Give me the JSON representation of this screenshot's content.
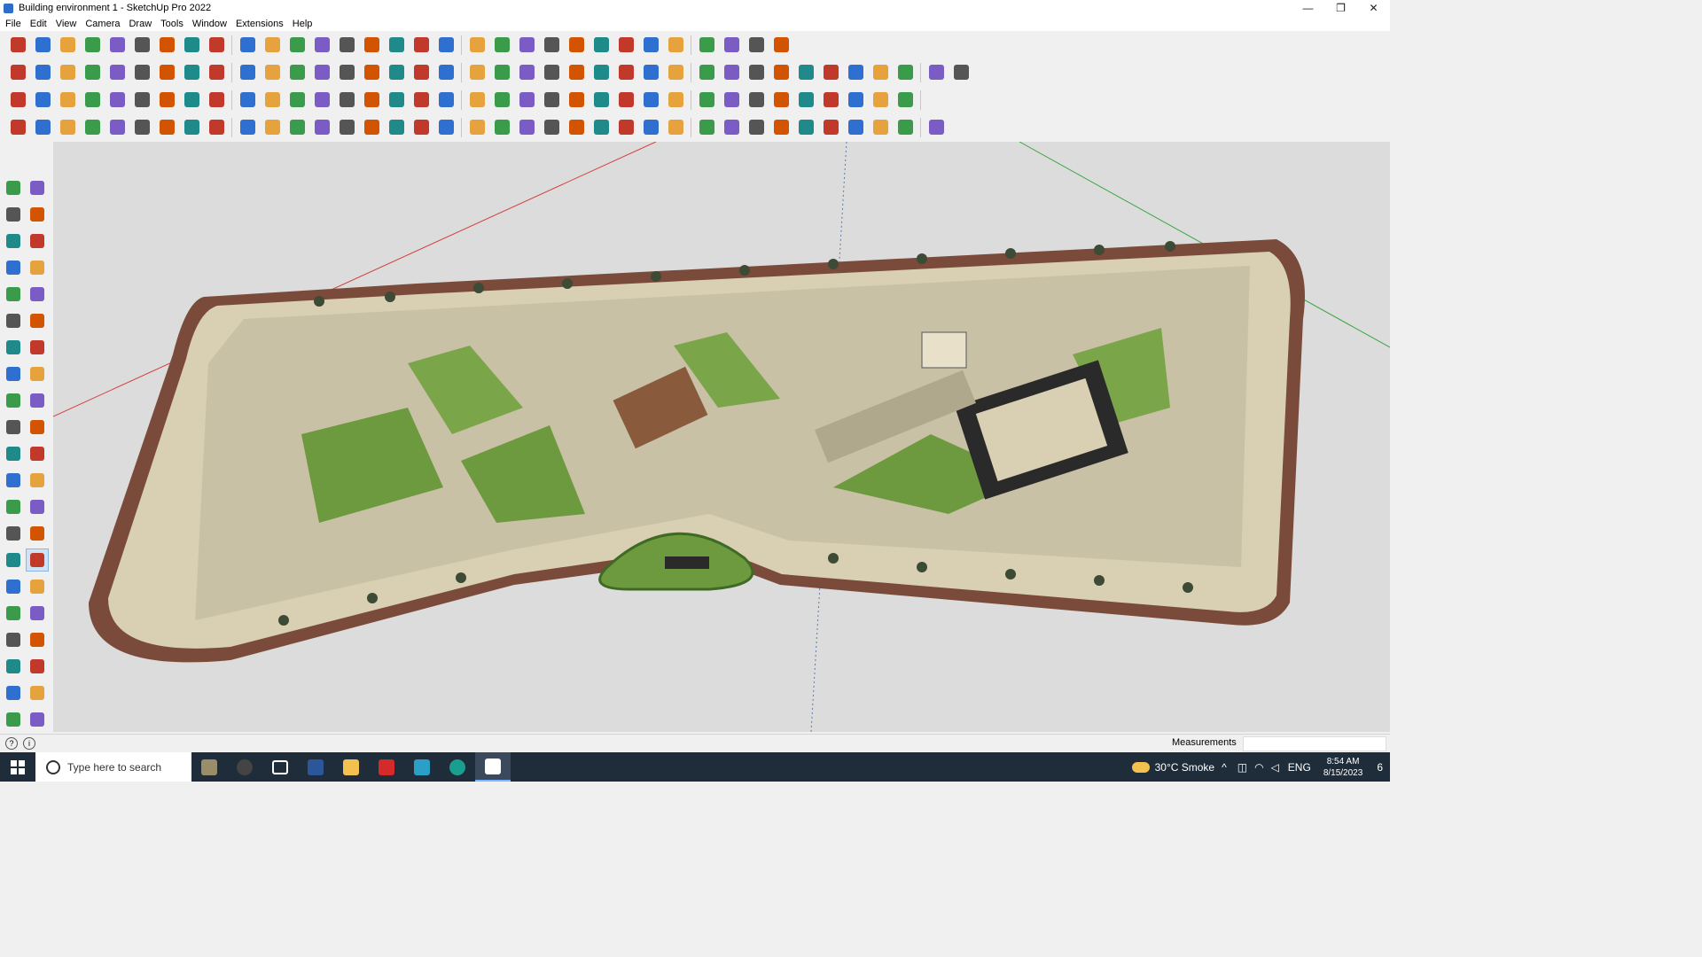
{
  "window": {
    "title": "Building environment 1 - SketchUp Pro 2022",
    "app_icon": "sketchup-icon",
    "minimize": "—",
    "restore": "❐",
    "close": "✕"
  },
  "menu": [
    "File",
    "Edit",
    "View",
    "Camera",
    "Draw",
    "Tools",
    "Window",
    "Extensions",
    "Help"
  ],
  "toolbars": {
    "row1": [
      "zoom-icon",
      "select-icon",
      "eraser-icon",
      "pencil-icon",
      "arc-icon",
      "rectangle-icon",
      "push-pull-icon",
      "follow-me-icon",
      "move-icon",
      "rotate-icon",
      "scale-icon",
      "tape-icon",
      "text-icon",
      "paint-icon",
      "orbit-icon",
      "pan-icon",
      "zoom-window-icon",
      "zoom-extents-icon",
      "warehouse-icon",
      "layers-icon",
      "styles-icon",
      "components-icon",
      "account-icon",
      "views-icon",
      "sections-icon",
      "axes-icon",
      "solids-icon",
      "sandbox-icon",
      "undo-icon",
      "redo-icon",
      "model-info-icon"
    ],
    "row2": [
      "iso-view-icon",
      "top-view-icon",
      "front-view-icon",
      "import-icon",
      "extrude-icon",
      "arrow-icon",
      "flip-icon",
      "mirror-icon",
      "copy-icon",
      "fillet-icon",
      "roof-icon",
      "wall-icon",
      "window-icon",
      "door-icon",
      "house-icon",
      "stairs-icon",
      "floor-icon",
      "formula-icon",
      "curve-icon",
      "line-icon",
      "square-icon",
      "circle-icon",
      "hexagon-icon",
      "ellipse-icon",
      "parallelogram-icon",
      "curve-tool-icon",
      "polygon-icon",
      "pen-icon",
      "shape-icon",
      "scale-tool-icon",
      "measure-icon",
      "eraser2-icon",
      "bezier-icon",
      "plane-icon",
      "grid-icon",
      "section-fill-icon",
      "tube-icon",
      "panel-icon"
    ],
    "row3": [
      "paint-bucket-icon",
      "ruler-icon",
      "label-icon",
      "attribute-icon",
      "close-small-icon",
      "triangle-icon",
      "loop-icon",
      "square-red-icon",
      "lines-icon",
      "panel-outline-icon",
      "bench-icon",
      "link-icon",
      "corner-icon",
      "node-icon",
      "cross-red-icon",
      "cross-green-icon",
      "cross-blue-icon",
      "cone-icon",
      "triangle-outline-icon",
      "lasso-icon",
      "cut-icon",
      "rotate-small-icon",
      "move-small-icon",
      "bucket-icon",
      "undo-red-icon",
      "component-icon",
      "bond-icon",
      "stack-icon",
      "gear-red-icon",
      "chip-icon",
      "structure-icon",
      "lattice-icon",
      "grid2-icon",
      "scatter-icon",
      "curve2-icon",
      "cube-icon"
    ],
    "row4": [
      "vertex-icon",
      "spline-icon",
      "terrain-icon",
      "draw-icon",
      "paper-icon",
      "flat-icon",
      "twist-icon",
      "pipe-icon",
      "gear-icon",
      "wrench-icon",
      "elbow-icon",
      "arrow-icon2",
      "pen-line-icon",
      "edge-icon",
      "brick-icon",
      "split-icon",
      "columns-icon",
      "bricks-icon",
      "hand-icon",
      "leaf-icon",
      "cone2-icon",
      "spiral-icon",
      "slope-icon",
      "wedge-icon",
      "dual-line-icon",
      "trio-line-icon",
      "glide-icon",
      "stairs2-icon",
      "panel2-icon",
      "cell-icon",
      "pattern-icon",
      "lattice2-icon",
      "mesh-icon",
      "vent-icon",
      "grid3-icon",
      "fan-icon",
      "bulge-icon"
    ]
  },
  "left_tools": [
    "select-icon",
    "orbit-icon",
    "paint-icon",
    "eraser-icon",
    "components-icon",
    "tag-icon",
    "line-icon",
    "freehand-icon",
    "rectangle-icon",
    "rotated-rect-icon",
    "circle-icon",
    "polygon-icon",
    "arc-icon",
    "2pt-arc-icon",
    "3pt-arc-icon",
    "pie-icon",
    "move-icon",
    "push-pull-icon",
    "rotate-icon",
    "follow-me-icon",
    "scale-icon",
    "offset-icon",
    "tape-icon",
    "dimension-icon",
    "protractor-icon",
    "text-icon",
    "axes-icon",
    "3d-text-icon",
    "orbit2-icon",
    "pan-icon",
    "zoom-icon",
    "zoom-window-icon",
    "zoom-extents-icon",
    "previous-icon",
    "position-camera-icon",
    "look-around-icon",
    "walk-icon",
    "section-icon",
    "warehouse-icon",
    "extension-icon",
    "layer-icon",
    "styles-icon"
  ],
  "status": {
    "measurements_label": "Measurements",
    "measurements_value": ""
  },
  "taskbar": {
    "search_placeholder": "Type here to search",
    "weather": "30°C  Smoke",
    "language": "ENG",
    "time": "8:54 AM",
    "date": "8/15/2023",
    "notification_count": "6"
  },
  "colors": {
    "accent": "#7ab6ff",
    "lawn": "#6d9a3e",
    "paving": "#d9cfb2",
    "wall": "#7a4b3a"
  }
}
